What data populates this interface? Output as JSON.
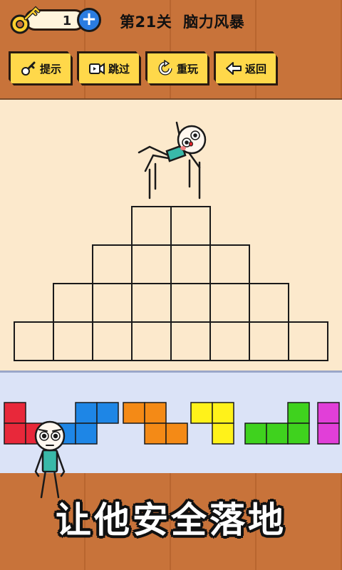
{
  "hud": {
    "key_count": "1",
    "add_key_label": "+",
    "level_number": "第21关",
    "level_category": "脑力风暴"
  },
  "toolbar": {
    "hint_label": "提示",
    "skip_label": "跳过",
    "replay_label": "重玩",
    "back_label": "返回"
  },
  "colors": {
    "toolbar_button": "#ffd84a",
    "play_area_bg": "#fce9cc",
    "shelf_bg": "#dbe3f7",
    "piece_red": "#e8283a",
    "piece_blue": "#1e86e6",
    "piece_orange": "#f48a16",
    "piece_yellow": "#fff21a",
    "piece_green": "#3fd21e",
    "piece_magenta": "#e13fd8"
  },
  "pyramid": {
    "rows": [
      2,
      4,
      6,
      8
    ]
  },
  "pieces": [
    {
      "name": "piece-red",
      "color": "#e8283a"
    },
    {
      "name": "piece-blue",
      "color": "#1e86e6"
    },
    {
      "name": "piece-orange",
      "color": "#f48a16"
    },
    {
      "name": "piece-yellow",
      "color": "#fff21a"
    },
    {
      "name": "piece-green",
      "color": "#3fd21e"
    },
    {
      "name": "piece-magenta",
      "color": "#e13fd8"
    }
  ],
  "caption": "让他安全落地"
}
